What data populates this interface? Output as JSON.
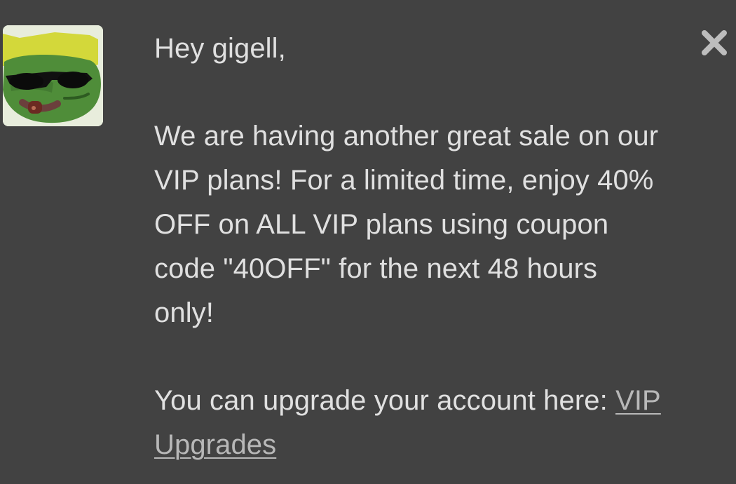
{
  "message": {
    "greeting": "Hey gigell,",
    "lines": [
      "We are having another great sale on our",
      "VIP plans! For a limited time, enjoy 40%",
      "OFF on ALL VIP plans using coupon",
      "code \"40OFF\" for the next 48 hours",
      "only!"
    ],
    "upgrade_prefix": "You can upgrade your account here: ",
    "upgrade_link_label_1": "VIP",
    "upgrade_link_label_2": "Upgrades"
  },
  "avatar": {
    "icon": "sunglasses-frog-avatar"
  },
  "controls": {
    "close_icon": "close-icon"
  },
  "colors": {
    "background": "#424242",
    "text": "#e0e0e0",
    "link": "#b8b8b8",
    "close": "#bdbdbd"
  }
}
